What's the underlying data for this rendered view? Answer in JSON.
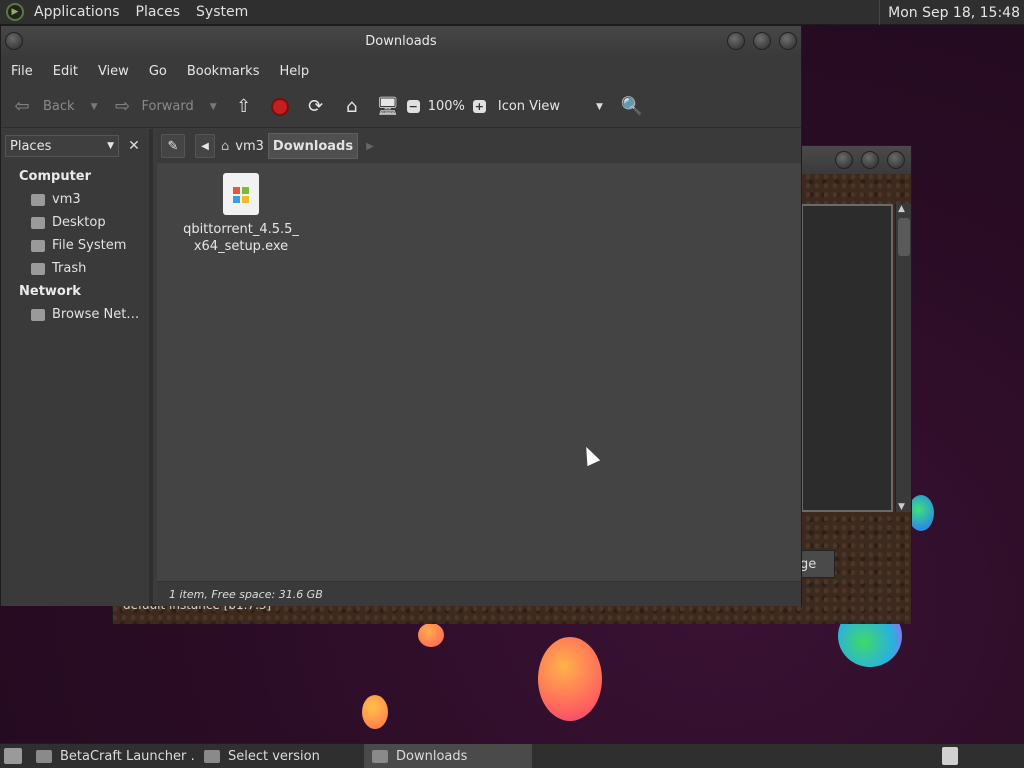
{
  "top_panel": {
    "menus": [
      "Applications",
      "Places",
      "System"
    ],
    "clock": "Mon Sep 18, 15:48"
  },
  "background_window": {
    "button_text": "ge",
    "instance_text": "default instance [b1.7.3]"
  },
  "file_manager": {
    "title": "Downloads",
    "menubar": [
      "File",
      "Edit",
      "View",
      "Go",
      "Bookmarks",
      "Help"
    ],
    "toolbar": {
      "back": "Back",
      "forward": "Forward",
      "zoom": "100%",
      "view_mode": "Icon View"
    },
    "sidepane": {
      "selector": "Places",
      "sections": [
        {
          "heading": "Computer",
          "items": [
            "vm3",
            "Desktop",
            "File System",
            "Trash"
          ]
        },
        {
          "heading": "Network",
          "items": [
            "Browse Net…"
          ]
        }
      ]
    },
    "breadcrumbs": [
      "vm3",
      "Downloads"
    ],
    "files": [
      {
        "name_line1": "qbittorrent_4.5.5_",
        "name_line2": "x64_setup.exe",
        "icon": "windows-exe-icon"
      }
    ],
    "status": "1 item, Free space: 31.6 GB"
  },
  "taskbar": {
    "tasks": [
      {
        "label": "BetaCraft Launcher …",
        "active": false
      },
      {
        "label": "Select version",
        "active": false
      },
      {
        "label": "Downloads",
        "active": true
      }
    ]
  },
  "colors": {
    "desktop": "#2a0c25",
    "window_bg": "#3c3c3c",
    "content_bg": "#444444",
    "stop_red": "#c42020"
  }
}
